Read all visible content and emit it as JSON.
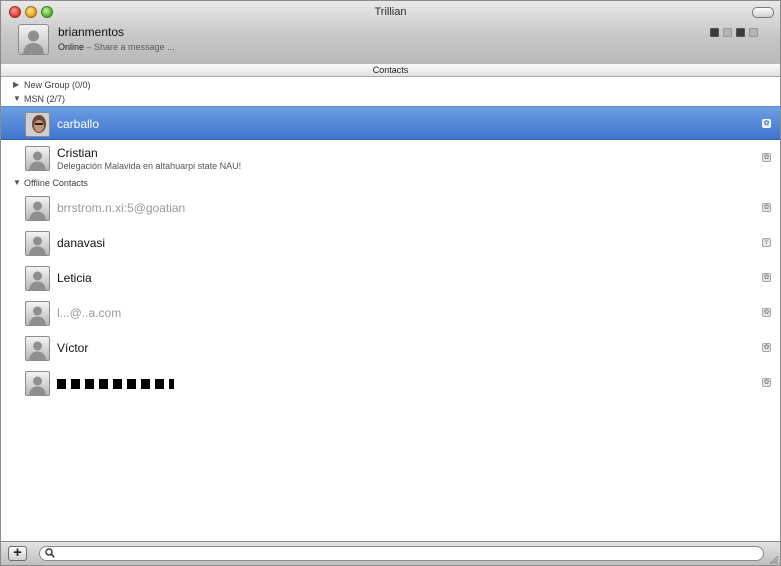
{
  "window": {
    "title": "Trillian"
  },
  "profile": {
    "name": "brianmentos",
    "status": "Online",
    "separator": " – ",
    "message_placeholder": "Share a message ..."
  },
  "contacts_header": "Contacts",
  "groups": [
    {
      "label": "New Group (0/0)",
      "expanded": false
    },
    {
      "label": "MSN (2/7)",
      "expanded": true
    },
    {
      "label": "Offline Contacts",
      "expanded": true
    }
  ],
  "contacts": [
    {
      "name": "carballo",
      "status": "",
      "selected": true
    },
    {
      "name": "Cristian",
      "status": "Delegación Malavida en altahuarpi state NAU!"
    },
    {
      "name": "brrstrom.n.xi:5@goatian",
      "status": ""
    },
    {
      "name": "danavasi",
      "status": ""
    },
    {
      "name": "Leticia",
      "status": ""
    },
    {
      "name": "l...@..a.com",
      "status": ""
    },
    {
      "name": "Víctor",
      "status": ""
    },
    {
      "name": "",
      "status": "",
      "censored": true
    }
  ],
  "icons": {
    "add": "plus-icon",
    "search": "magnifier-icon",
    "protocol": "msn-icon"
  },
  "colors": {
    "selection": "#4a80d6",
    "titlebar": "#c7c7c7"
  }
}
